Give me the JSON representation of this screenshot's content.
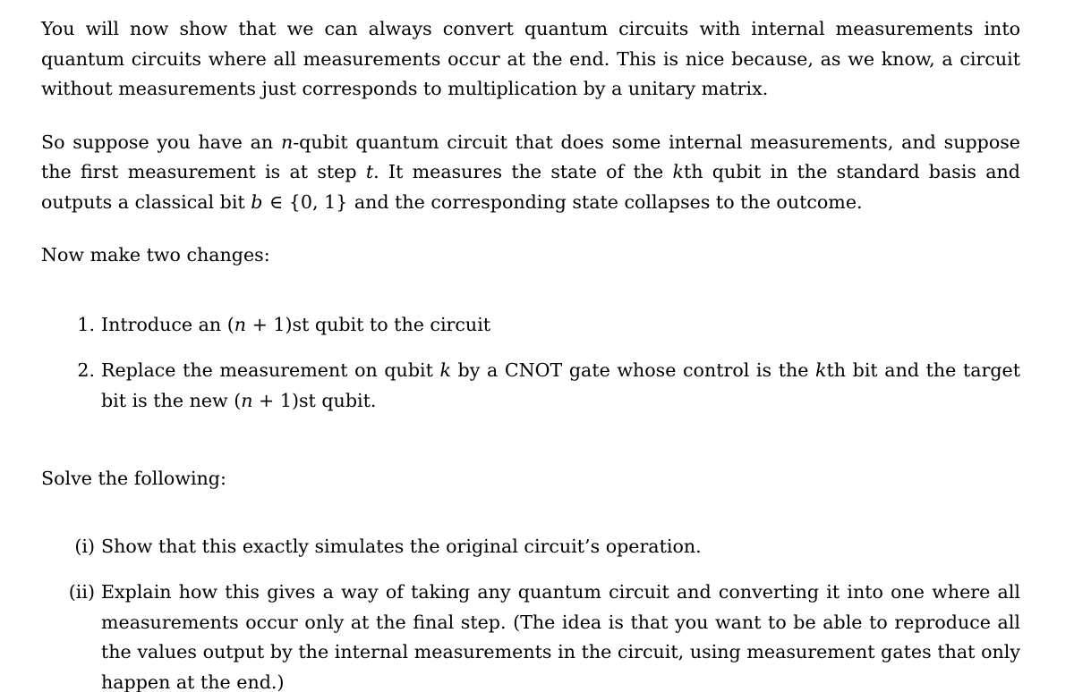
{
  "document": {
    "background_color": "#ffffff",
    "text_color": "#000000",
    "paragraphs": {
      "p1": "You will now show that we can always convert quantum circuits with internal measurements into quantum circuits where all measurements occur at the end.  This is nice because, as we know, a circuit without measurements just corresponds to multiplication by a unitary matrix.",
      "p2_a": "So suppose you have an ",
      "p2_var1": "n",
      "p2_b": "-qubit quantum circuit that does some internal measurements, and suppose the first measurement is at step ",
      "p2_var2": "t",
      "p2_c": ".  It measures the state of the ",
      "p2_var3": "k",
      "p2_d": "th qubit in the standard basis and outputs a classical bit ",
      "p2_var4": "b",
      "p2_set": " ∈ {0, 1}",
      "p2_e": " and the corresponding state collapses to the outcome.",
      "p3": "Now make two changes:",
      "p4": "Solve the following:"
    },
    "numbered_list": [
      {
        "marker": "1.",
        "text_a": "Introduce an (",
        "var": "n",
        "text_b": " + 1)st qubit to the circuit"
      },
      {
        "marker": "2.",
        "text_a": "Replace the measurement on qubit ",
        "var1": "k",
        "text_b": " by a CNOT gate whose control is the ",
        "var2": "k",
        "text_c": "th bit and the target bit is the new (",
        "var3": "n",
        "text_d": " + 1)st qubit."
      }
    ],
    "roman_list": [
      {
        "marker": "(i)",
        "text": "Show that this exactly simulates the original circuit’s operation."
      },
      {
        "marker": "(ii)",
        "text": "Explain how this gives a way of taking any quantum circuit and converting it into one where all measurements occur only at the final step.  (The idea is that you want to be able to reproduce all the values output by the internal measurements in the circuit, using measurement gates that only happen at the end.)"
      }
    ]
  }
}
